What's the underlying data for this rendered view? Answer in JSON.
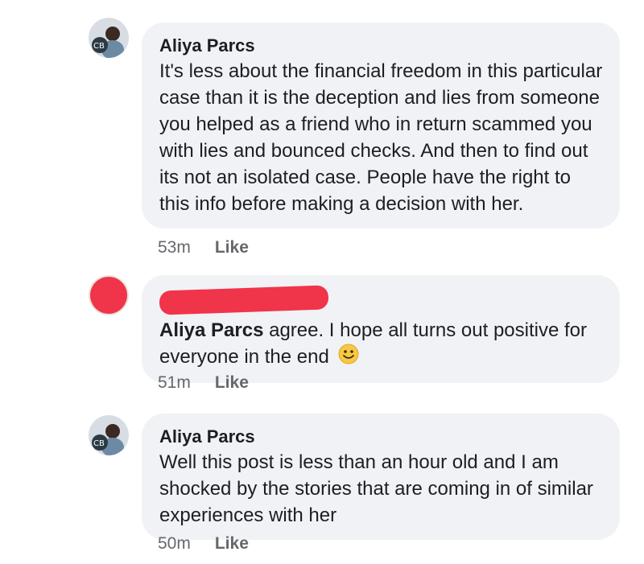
{
  "comments": [
    {
      "author": "Aliya Parcs",
      "text": "It's less about the financial freedom in this particular case than it is the deception and lies from someone you helped as a friend who in return scammed you with lies and bounced checks. And then to find out its not an isolated case. People have the right to this info before making a decision with her.",
      "time": "53m",
      "like_label": "Like"
    },
    {
      "author": "",
      "mention": "Aliya Parcs",
      "text": " agree. I hope all turns out positive for everyone in the end",
      "emoji": "smiley-emoji-icon",
      "time": "51m",
      "like_label": "Like"
    },
    {
      "author": "Aliya Parcs",
      "text": "Well this post is less than an hour old and I am shocked by the stories that are coming in of similar experiences with her",
      "time": "50m",
      "like_label": "Like"
    }
  ],
  "colors": {
    "bubble": "#f0f2f5",
    "redaction": "#f0344a",
    "meta_text": "#65676b"
  }
}
